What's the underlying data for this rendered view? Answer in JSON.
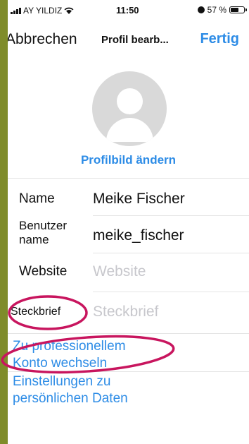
{
  "status_bar": {
    "carrier": "AY YILDIZ",
    "time": "11:50",
    "battery": "57 %"
  },
  "nav": {
    "cancel_label": "Abbrechen",
    "title": "Profil bearb...",
    "done_label": "Fertig"
  },
  "profile": {
    "change_photo_label": "Profilbild ändern"
  },
  "fields": {
    "name": {
      "label": "Name",
      "value": "Meike Fischer"
    },
    "username": {
      "label_line1": "Benutzer",
      "label_line2": "name",
      "value": "meike_fischer"
    },
    "website": {
      "label": "Website",
      "placeholder": "Website"
    },
    "bio": {
      "label": "Steckbrief",
      "placeholder": "Steckbrief"
    }
  },
  "links": {
    "professional_line1": "Zu professionellem",
    "professional_line2": "Konto wechseln",
    "personal_line1": "Einstellungen zu",
    "personal_line2": "persönlichen Daten"
  },
  "colors": {
    "accent": "#2d8ce6",
    "annotation": "#c8155e",
    "frame": "#7f8c2a"
  }
}
